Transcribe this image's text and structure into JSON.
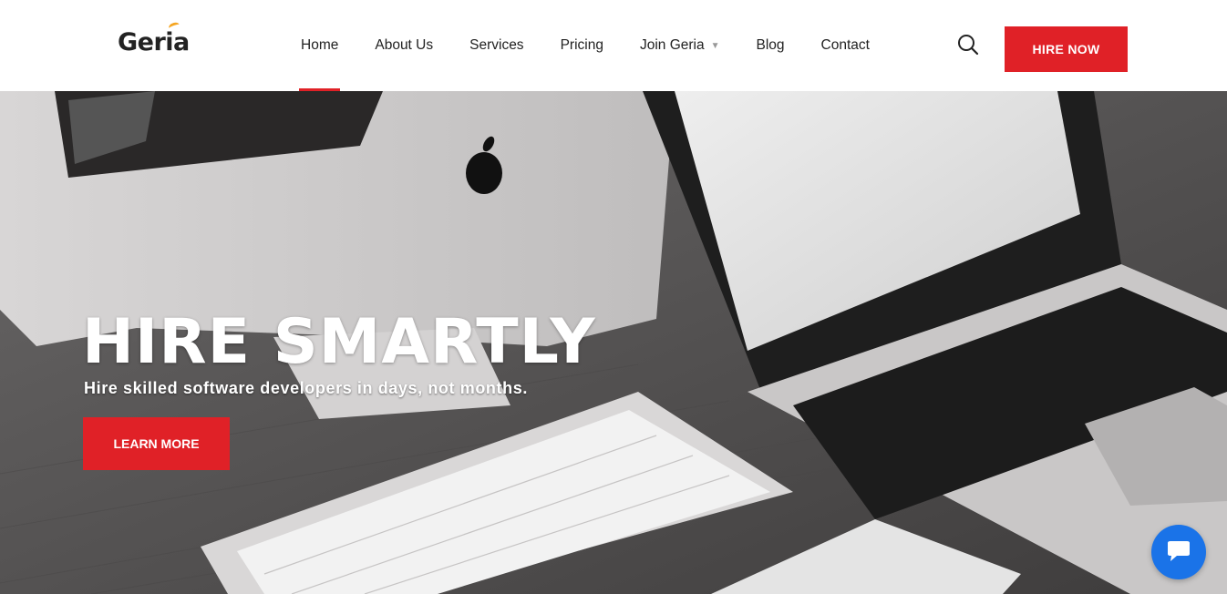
{
  "brand": {
    "name": "Geria",
    "accent_color": "#e02127",
    "logo_dot_color": "#f5a623"
  },
  "nav": {
    "items": [
      {
        "label": "Home",
        "active": true
      },
      {
        "label": "About Us"
      },
      {
        "label": "Services"
      },
      {
        "label": "Pricing"
      },
      {
        "label": "Join Geria",
        "has_dropdown": true,
        "dropdown_icon": "caret-down"
      },
      {
        "label": "Blog"
      },
      {
        "label": "Contact"
      }
    ],
    "search_icon": "search-icon",
    "cta_label": "HIRE NOW"
  },
  "hero": {
    "title": "HIRE SMARTLY",
    "subtitle": "Hire skilled software developers in days, not months.",
    "cta_label": "LEARN MORE",
    "background_image": "grayscale desk with iMac, MacBook Pro and keyboard",
    "laptop_label": "MacBook Pro"
  },
  "chat_widget": {
    "icon": "chat-bubble-icon",
    "color": "#1a73e8"
  }
}
